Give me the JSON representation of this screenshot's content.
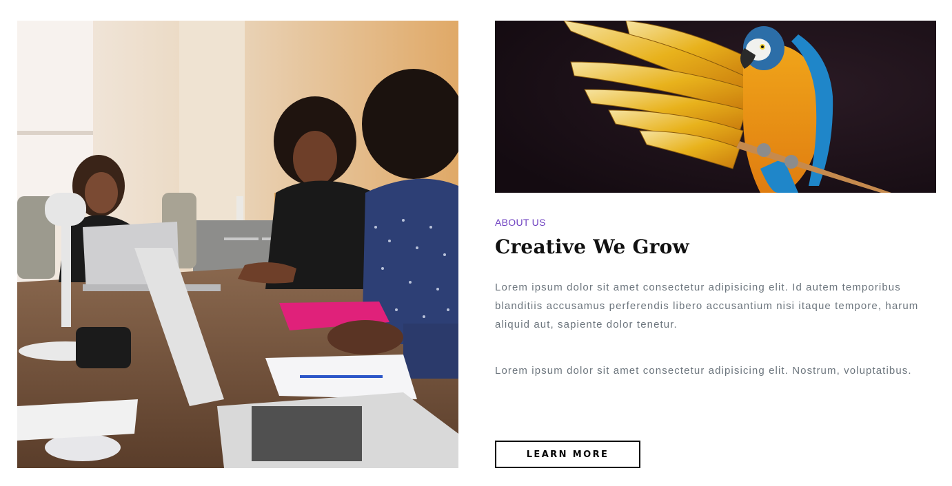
{
  "about": {
    "eyebrow": "ABOUT US",
    "title": "Creative We Grow",
    "paragraphs": [
      "Lorem ipsum dolor sit amet consectetur adipisicing elit. Id autem temporibus blanditiis accusamus perferendis libero accusantium nisi itaque tempore, harum aliquid aut, sapiente dolor tenetur.",
      "Lorem ipsum dolor sit amet consectetur adipisicing elit. Nostrum, voluptatibus."
    ],
    "button_label": "LEARN MORE"
  },
  "images": {
    "left_alt": "Team meeting at a conference table",
    "right_alt": "Macaw parrot with spread wings"
  },
  "colors": {
    "accent": "#6f42c1",
    "heading": "#111111",
    "body_text": "#6c757d",
    "button_border": "#000000"
  }
}
